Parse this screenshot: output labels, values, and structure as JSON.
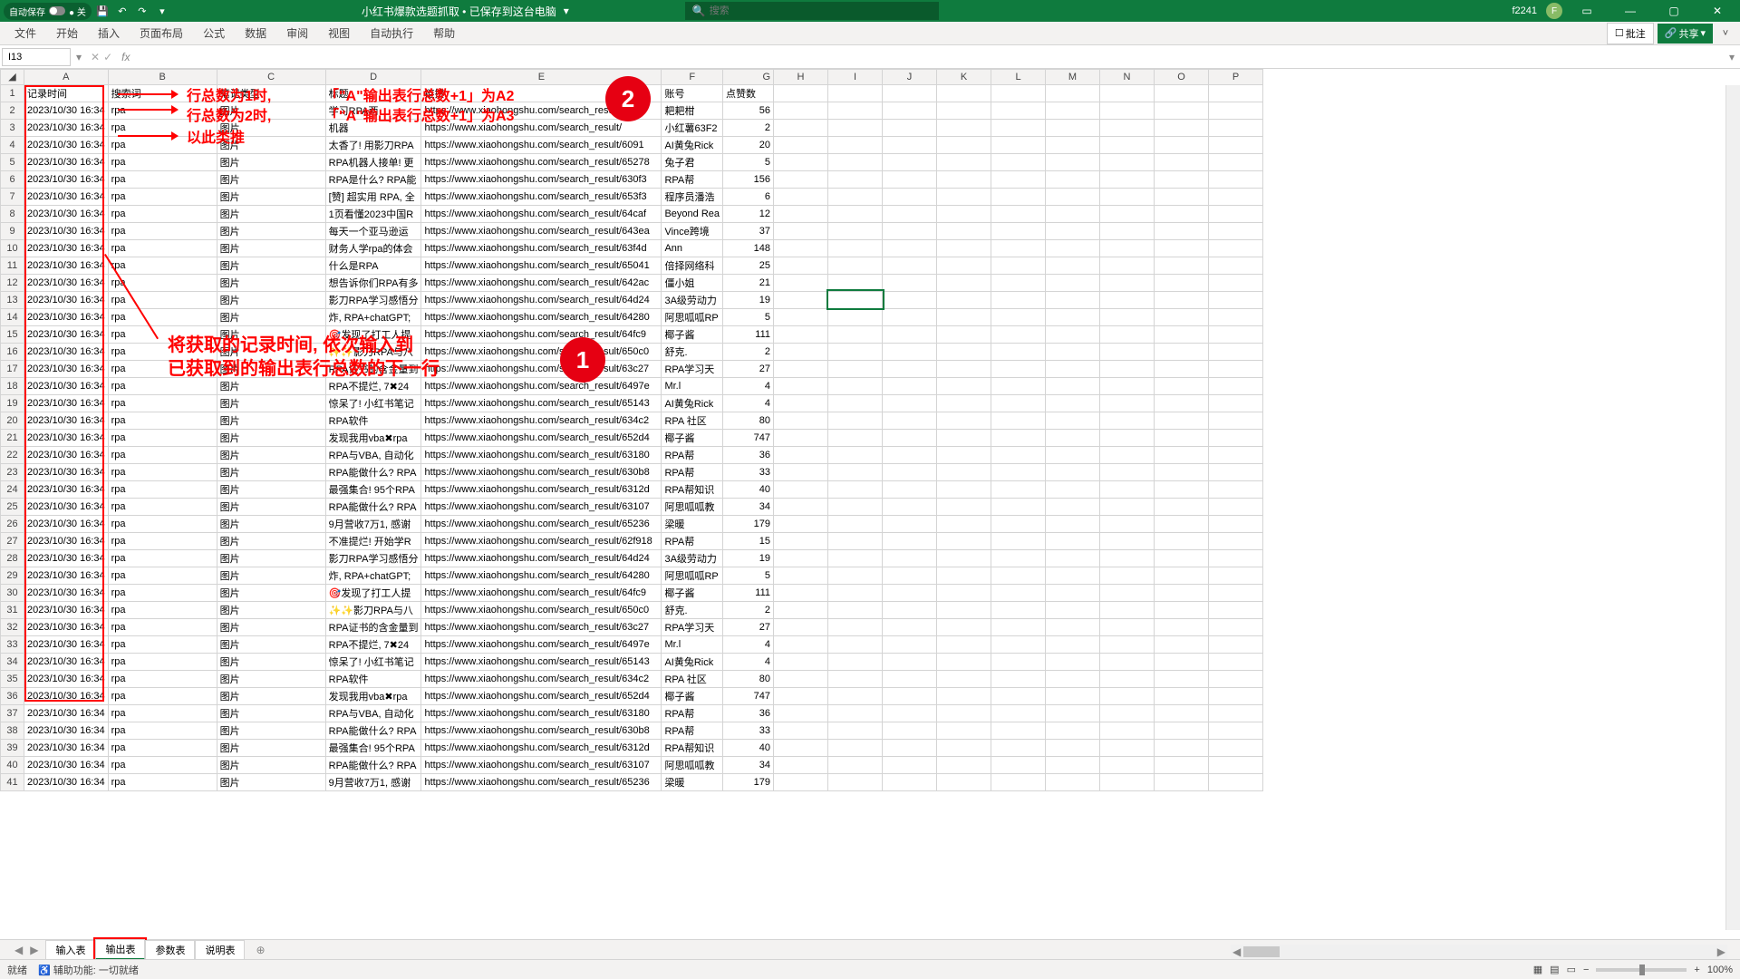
{
  "titlebar": {
    "autosave": "自动保存",
    "autosave_state": "● 关",
    "filename": "小红书爆款选题抓取 • 已保存到这台电脑",
    "search_placeholder": "搜索",
    "user": "f2241",
    "avatar_initial": "F"
  },
  "ribbon": {
    "tabs": [
      "文件",
      "开始",
      "插入",
      "页面布局",
      "公式",
      "数据",
      "审阅",
      "视图",
      "自动执行",
      "帮助"
    ],
    "comments": "批注",
    "share": "共享"
  },
  "fx": {
    "cell": "I13",
    "fx_label": "fx"
  },
  "columns": [
    "A",
    "B",
    "C",
    "D",
    "E",
    "F",
    "G",
    "H",
    "I",
    "J",
    "K",
    "L",
    "M",
    "N",
    "O",
    "P"
  ],
  "headers": {
    "A": "记录时间",
    "B": "搜索词",
    "C": "笔记类型",
    "D": "标题",
    "E": "链接",
    "F": "账号",
    "G": "点赞数"
  },
  "rows": [
    {
      "a": "2023/10/30 16:34",
      "b": "rpa",
      "c": "图片",
      "d": "学习RPA两",
      "e": "https://www.xiaohongshu.com/search_result/",
      "f": "耙耙柑",
      "g": 56
    },
    {
      "a": "2023/10/30 16:34",
      "b": "rpa",
      "c": "图片",
      "d": "机器",
      "e": "https://www.xiaohongshu.com/search_result/",
      "f": "小红薯63F2",
      "g": 2
    },
    {
      "a": "2023/10/30 16:34",
      "b": "rpa",
      "c": "图片",
      "d": "太香了! 用影刀RPA",
      "e": "https://www.xiaohongshu.com/search_result/6091",
      "f": "AI黄兔Rick",
      "g": 20
    },
    {
      "a": "2023/10/30 16:34",
      "b": "rpa",
      "c": "图片",
      "d": "RPA机器人接单! 更",
      "e": "https://www.xiaohongshu.com/search_result/65278",
      "f": "兔子君",
      "g": 5
    },
    {
      "a": "2023/10/30 16:34",
      "b": "rpa",
      "c": "图片",
      "d": "RPA是什么? RPA能",
      "e": "https://www.xiaohongshu.com/search_result/630f3",
      "f": "RPA帮",
      "g": 156
    },
    {
      "a": "2023/10/30 16:34",
      "b": "rpa",
      "c": "图片",
      "d": "[赞] 超实用 RPA, 全",
      "e": "https://www.xiaohongshu.com/search_result/653f3",
      "f": "程序员潘浩",
      "g": 6
    },
    {
      "a": "2023/10/30 16:34",
      "b": "rpa",
      "c": "图片",
      "d": "1页看懂2023中国R",
      "e": "https://www.xiaohongshu.com/search_result/64caf",
      "f": "Beyond Rea",
      "g": 12
    },
    {
      "a": "2023/10/30 16:34",
      "b": "rpa",
      "c": "图片",
      "d": "每天一个亚马逊运",
      "e": "https://www.xiaohongshu.com/search_result/643ea",
      "f": "Vince跨境",
      "g": 37
    },
    {
      "a": "2023/10/30 16:34",
      "b": "rpa",
      "c": "图片",
      "d": "财务人学rpa的体会",
      "e": "https://www.xiaohongshu.com/search_result/63f4d",
      "f": "Ann",
      "g": 148
    },
    {
      "a": "2023/10/30 16:34",
      "b": "rpa",
      "c": "图片",
      "d": "什么是RPA",
      "e": "https://www.xiaohongshu.com/search_result/65041",
      "f": "倍择网络科",
      "g": 25
    },
    {
      "a": "2023/10/30 16:34",
      "b": "rpa",
      "c": "图片",
      "d": "想告诉你们RPA有多",
      "e": "https://www.xiaohongshu.com/search_result/642ac",
      "f": "僵小姐",
      "g": 21
    },
    {
      "a": "2023/10/30 16:34",
      "b": "rpa",
      "c": "图片",
      "d": "影刀RPA学习感悟分",
      "e": "https://www.xiaohongshu.com/search_result/64d24",
      "f": "3A级劳动力",
      "g": 19
    },
    {
      "a": "2023/10/30 16:34",
      "b": "rpa",
      "c": "图片",
      "d": "炸, RPA+chatGPT;",
      "e": "https://www.xiaohongshu.com/search_result/64280",
      "f": "阿思呱呱RP",
      "g": 5
    },
    {
      "a": "2023/10/30 16:34",
      "b": "rpa",
      "c": "图片",
      "d": "🎯发现了打工人提",
      "e": "https://www.xiaohongshu.com/search_result/64fc9",
      "f": "椰子酱",
      "g": 111
    },
    {
      "a": "2023/10/30 16:34",
      "b": "rpa",
      "c": "图片",
      "d": "✨✨影刀RPA与八",
      "e": "https://www.xiaohongshu.com/search_result/650c0",
      "f": "舒克.",
      "g": 2
    },
    {
      "a": "2023/10/30 16:34",
      "b": "rpa",
      "c": "图片",
      "d": "RPA证书的含金量到",
      "e": "https://www.xiaohongshu.com/search_result/63c27",
      "f": "RPA学习天",
      "g": 27
    },
    {
      "a": "2023/10/30 16:34",
      "b": "rpa",
      "c": "图片",
      "d": "RPA不提烂, 7✖24",
      "e": "https://www.xiaohongshu.com/search_result/6497e",
      "f": "Mr.l",
      "g": 4
    },
    {
      "a": "2023/10/30 16:34",
      "b": "rpa",
      "c": "图片",
      "d": "惊呆了! 小红书笔记",
      "e": "https://www.xiaohongshu.com/search_result/65143",
      "f": "AI黄兔Rick",
      "g": 4
    },
    {
      "a": "2023/10/30 16:34",
      "b": "rpa",
      "c": "图片",
      "d": "RPA软件",
      "e": "https://www.xiaohongshu.com/search_result/634c2",
      "f": "RPA 社区",
      "g": 80
    },
    {
      "a": "2023/10/30 16:34",
      "b": "rpa",
      "c": "图片",
      "d": "发现我用vba✖rpa",
      "e": "https://www.xiaohongshu.com/search_result/652d4",
      "f": "椰子酱",
      "g": 747
    },
    {
      "a": "2023/10/30 16:34",
      "b": "rpa",
      "c": "图片",
      "d": "RPA与VBA, 自动化",
      "e": "https://www.xiaohongshu.com/search_result/63180",
      "f": "RPA帮",
      "g": 36
    },
    {
      "a": "2023/10/30 16:34",
      "b": "rpa",
      "c": "图片",
      "d": "RPA能做什么? RPA",
      "e": "https://www.xiaohongshu.com/search_result/630b8",
      "f": "RPA帮",
      "g": 33
    },
    {
      "a": "2023/10/30 16:34",
      "b": "rpa",
      "c": "图片",
      "d": "最强集合! 95个RPA",
      "e": "https://www.xiaohongshu.com/search_result/6312d",
      "f": "RPA帮知识",
      "g": 40
    },
    {
      "a": "2023/10/30 16:34",
      "b": "rpa",
      "c": "图片",
      "d": "RPA能做什么? RPA",
      "e": "https://www.xiaohongshu.com/search_result/63107",
      "f": "阿思呱呱教",
      "g": 34
    },
    {
      "a": "2023/10/30 16:34",
      "b": "rpa",
      "c": "图片",
      "d": "9月营收7万1, 感谢",
      "e": "https://www.xiaohongshu.com/search_result/65236",
      "f": "梁暖",
      "g": 179
    },
    {
      "a": "2023/10/30 16:34",
      "b": "rpa",
      "c": "图片",
      "d": "不准提烂! 开始学R",
      "e": "https://www.xiaohongshu.com/search_result/62f918",
      "f": "RPA帮",
      "g": 15
    },
    {
      "a": "2023/10/30 16:34",
      "b": "rpa",
      "c": "图片",
      "d": "影刀RPA学习感悟分",
      "e": "https://www.xiaohongshu.com/search_result/64d24",
      "f": "3A级劳动力",
      "g": 19
    },
    {
      "a": "2023/10/30 16:34",
      "b": "rpa",
      "c": "图片",
      "d": "炸, RPA+chatGPT;",
      "e": "https://www.xiaohongshu.com/search_result/64280",
      "f": "阿思呱呱RP",
      "g": 5
    },
    {
      "a": "2023/10/30 16:34",
      "b": "rpa",
      "c": "图片",
      "d": "🎯发现了打工人提",
      "e": "https://www.xiaohongshu.com/search_result/64fc9",
      "f": "椰子酱",
      "g": 111
    },
    {
      "a": "2023/10/30 16:34",
      "b": "rpa",
      "c": "图片",
      "d": "✨✨影刀RPA与八",
      "e": "https://www.xiaohongshu.com/search_result/650c0",
      "f": "舒克.",
      "g": 2
    },
    {
      "a": "2023/10/30 16:34",
      "b": "rpa",
      "c": "图片",
      "d": "RPA证书的含金量到",
      "e": "https://www.xiaohongshu.com/search_result/63c27",
      "f": "RPA学习天",
      "g": 27
    },
    {
      "a": "2023/10/30 16:34",
      "b": "rpa",
      "c": "图片",
      "d": "RPA不提烂, 7✖24",
      "e": "https://www.xiaohongshu.com/search_result/6497e",
      "f": "Mr.l",
      "g": 4
    },
    {
      "a": "2023/10/30 16:34",
      "b": "rpa",
      "c": "图片",
      "d": "惊呆了! 小红书笔记",
      "e": "https://www.xiaohongshu.com/search_result/65143",
      "f": "AI黄兔Rick",
      "g": 4
    },
    {
      "a": "2023/10/30 16:34",
      "b": "rpa",
      "c": "图片",
      "d": "RPA软件",
      "e": "https://www.xiaohongshu.com/search_result/634c2",
      "f": "RPA 社区",
      "g": 80
    },
    {
      "a": "2023/10/30 16:34",
      "b": "rpa",
      "c": "图片",
      "d": "发现我用vba✖rpa",
      "e": "https://www.xiaohongshu.com/search_result/652d4",
      "f": "椰子酱",
      "g": 747
    },
    {
      "a": "2023/10/30 16:34",
      "b": "rpa",
      "c": "图片",
      "d": "RPA与VBA, 自动化",
      "e": "https://www.xiaohongshu.com/search_result/63180",
      "f": "RPA帮",
      "g": 36
    },
    {
      "a": "2023/10/30 16:34",
      "b": "rpa",
      "c": "图片",
      "d": "RPA能做什么? RPA",
      "e": "https://www.xiaohongshu.com/search_result/630b8",
      "f": "RPA帮",
      "g": 33
    },
    {
      "a": "2023/10/30 16:34",
      "b": "rpa",
      "c": "图片",
      "d": "最强集合! 95个RPA",
      "e": "https://www.xiaohongshu.com/search_result/6312d",
      "f": "RPA帮知识",
      "g": 40
    },
    {
      "a": "2023/10/30 16:34",
      "b": "rpa",
      "c": "图片",
      "d": "RPA能做什么? RPA",
      "e": "https://www.xiaohongshu.com/search_result/63107",
      "f": "阿思呱呱教",
      "g": 34
    },
    {
      "a": "2023/10/30 16:34",
      "b": "rpa",
      "c": "图片",
      "d": "9月营收7万1, 感谢",
      "e": "https://www.xiaohongshu.com/search_result/65236",
      "f": "梁暖",
      "g": 179
    }
  ],
  "annotations": {
    "line1_a": "行总数为1时,",
    "line1_b": "「\"A\"输出表行总数+1」为A2",
    "line2_a": "行总数为2时,",
    "line2_b": "「\"A\"输出表行总数+1」为A3",
    "line3": "以此类推",
    "main_a": "将获取的记录时间, 依次输入到",
    "main_b": "已获取到的输出表行总数的下一行",
    "badge1": "1",
    "badge2": "2"
  },
  "sheets": [
    "输入表",
    "输出表",
    "参数表",
    "说明表"
  ],
  "status": {
    "ready": "就绪",
    "access": "辅助功能: 一切就绪",
    "zoom": "100%"
  }
}
